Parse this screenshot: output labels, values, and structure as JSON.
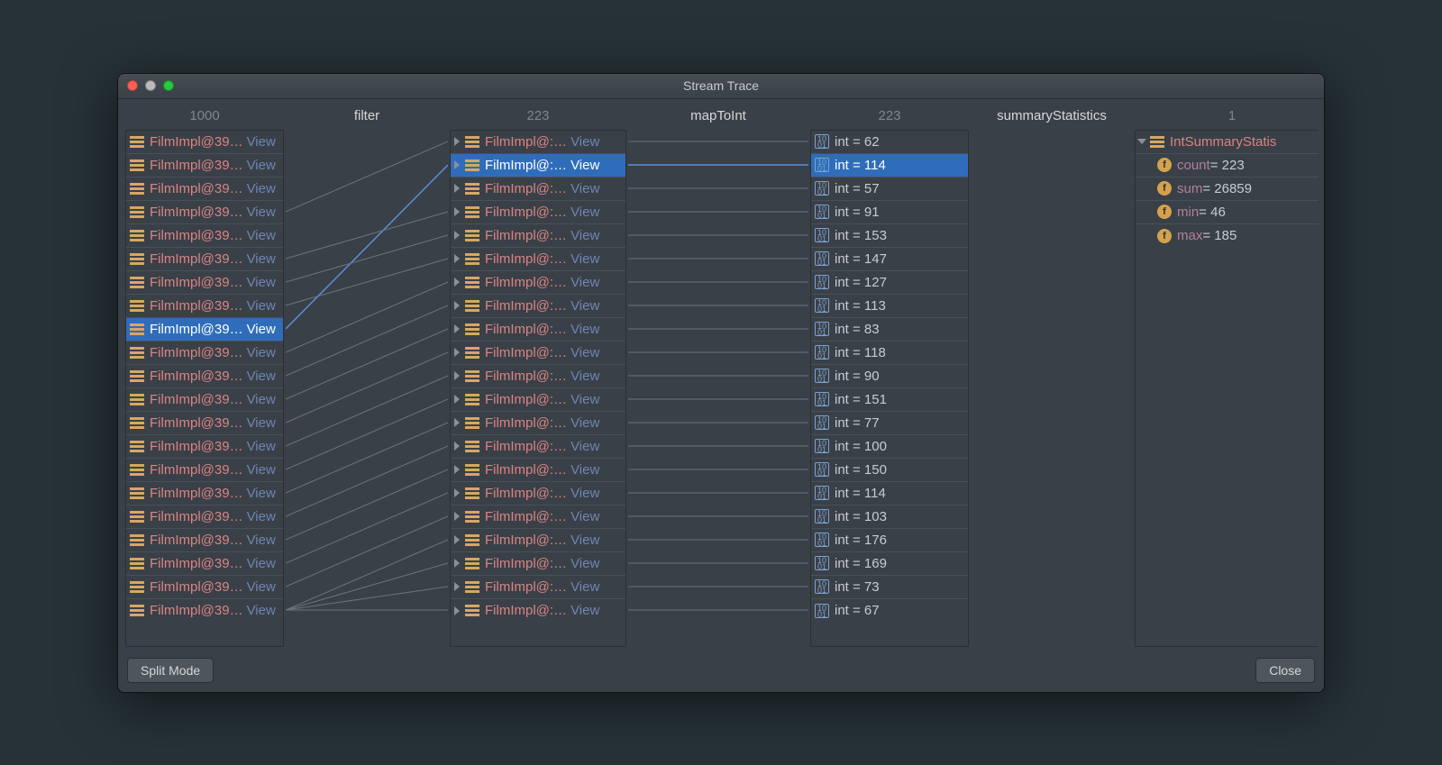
{
  "window": {
    "title": "Stream Trace"
  },
  "headers": [
    "1000",
    "filter",
    "223",
    "mapToInt",
    "223",
    "summaryStatistics",
    "1"
  ],
  "film": {
    "label": "FilmImpl@39…",
    "label2": "FilmImpl@:…",
    "view": "View"
  },
  "col1_selected_index": 8,
  "col3_selected_index": 1,
  "col5_selected_index": 1,
  "int_prefix": "int = ",
  "int_values": [
    62,
    114,
    57,
    91,
    153,
    147,
    127,
    113,
    83,
    118,
    90,
    151,
    77,
    100,
    150,
    114,
    103,
    176,
    169,
    73,
    67
  ],
  "summary": {
    "type_label": "IntSummaryStatis",
    "fields": [
      {
        "name": "count",
        "value": "223"
      },
      {
        "name": "sum",
        "value": "26859"
      },
      {
        "name": "min",
        "value": "46"
      },
      {
        "name": "max",
        "value": "185"
      }
    ]
  },
  "footer": {
    "split_mode": "Split Mode",
    "close": "Close"
  }
}
